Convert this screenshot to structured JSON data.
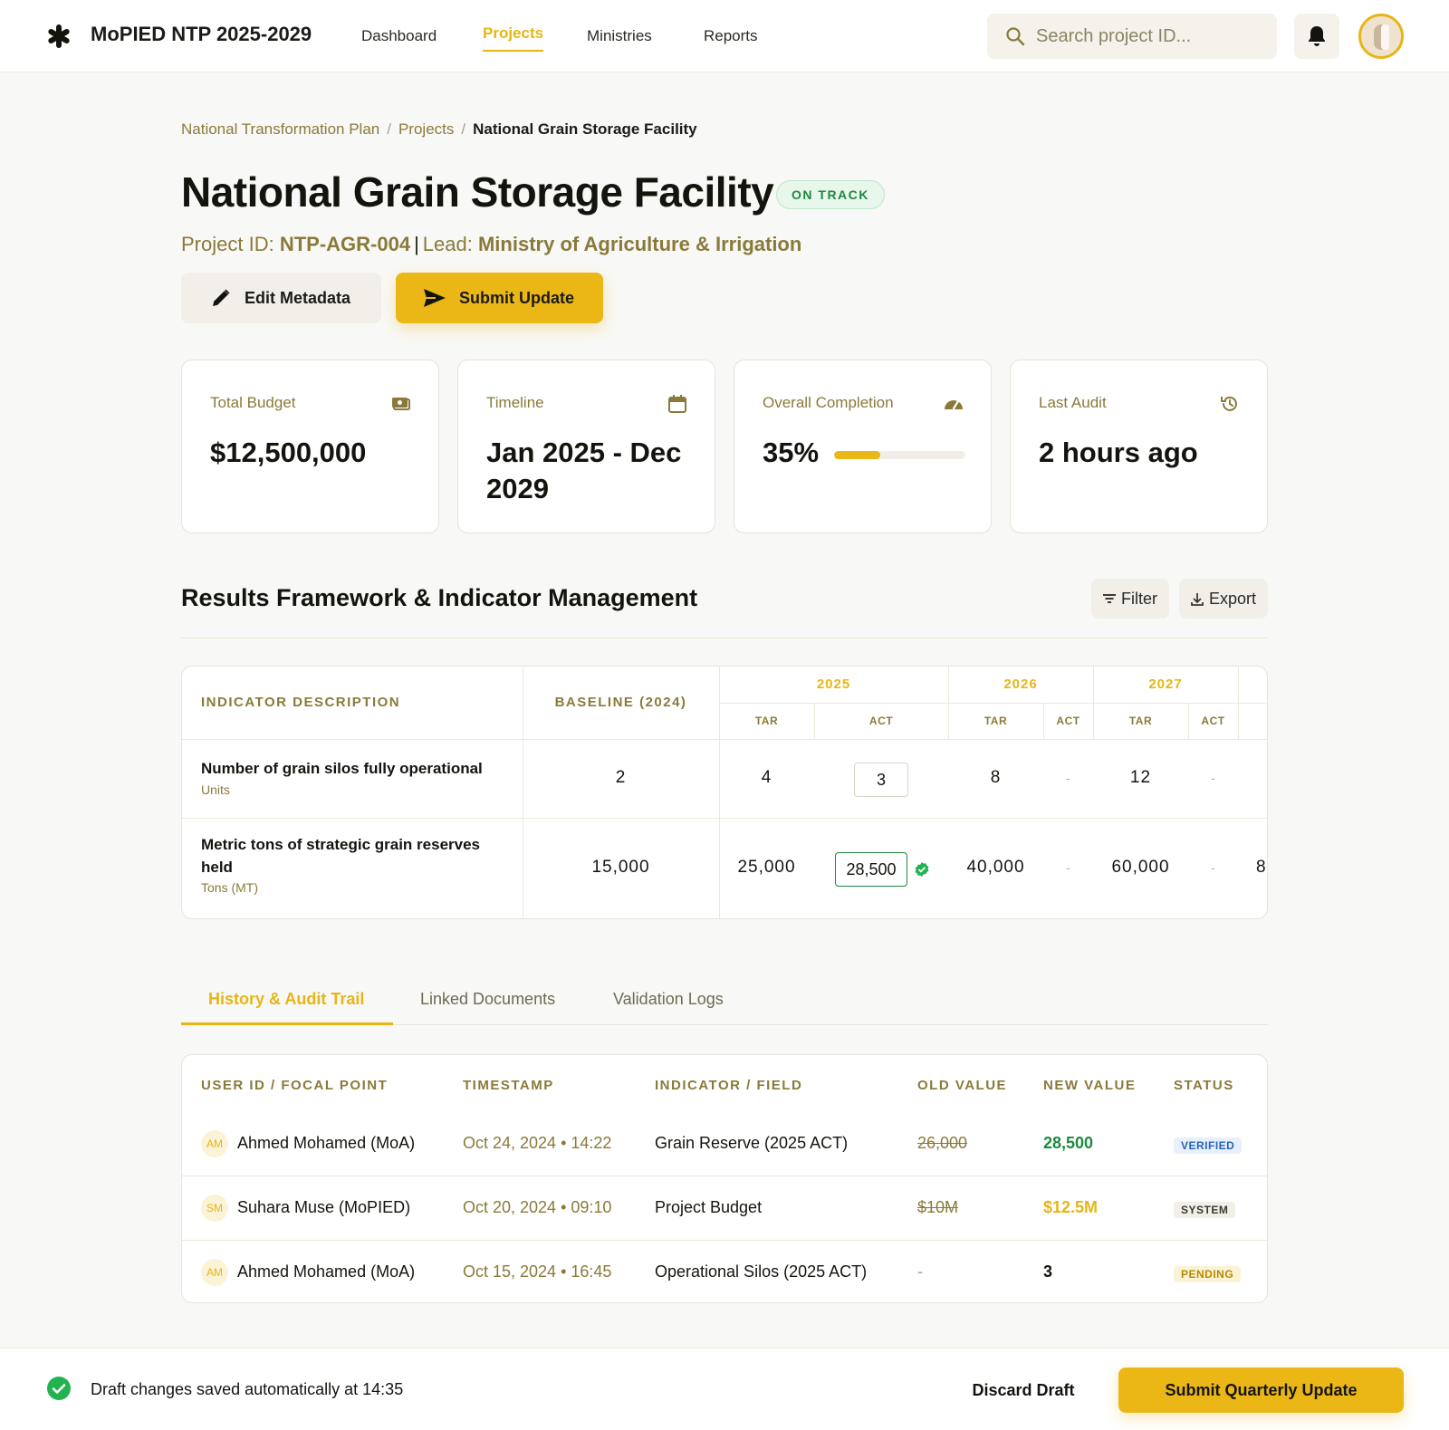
{
  "app": {
    "brand": "MoPIED NTP 2025-2029",
    "nav": [
      {
        "label": "Dashboard",
        "active": false
      },
      {
        "label": "Projects",
        "active": true
      },
      {
        "label": "Ministries",
        "active": false
      },
      {
        "label": "Reports",
        "active": false
      }
    ],
    "search_placeholder": "Search project ID...",
    "accent_color": "#ebb716"
  },
  "breadcrumb": [
    "National Transformation Plan",
    "Projects",
    "National Grain Storage Facility"
  ],
  "project": {
    "title": "National Grain Storage Facility",
    "status": "ON TRACK",
    "id_label": "Project ID:",
    "id": "NTP-AGR-004",
    "lead_label": "Lead:",
    "lead": "Ministry of Agriculture & Irrigation"
  },
  "actions": {
    "edit": "Edit Metadata",
    "submit": "Submit Update"
  },
  "cards": [
    {
      "label": "Total Budget",
      "value": "$12,500,000",
      "icon": "money-icon"
    },
    {
      "label": "Timeline",
      "value": "Jan 2025 - Dec 2029",
      "icon": "calendar-icon"
    },
    {
      "label": "Overall Completion",
      "value": "35%",
      "progress": 35,
      "icon": "gauge-icon"
    },
    {
      "label": "Last Audit",
      "value": "2 hours ago",
      "icon": "history-icon"
    }
  ],
  "results": {
    "title": "Results Framework & Indicator Management",
    "filter": "Filter",
    "export": "Export",
    "headers": {
      "indicator": "INDICATOR DESCRIPTION",
      "baseline": "BASELINE (2024)",
      "years": [
        "2025",
        "2026",
        "2027"
      ],
      "tar": "TAR",
      "act": "ACT"
    },
    "rows": [
      {
        "name": "Number of grain silos fully operational",
        "unit": "Units",
        "baseline": "2",
        "t2025": "4",
        "a2025": "3",
        "t2026": "8",
        "a2026": "-",
        "t2027": "12",
        "a2027": "-",
        "overflow": ""
      },
      {
        "name": "Metric tons of strategic grain reserves held",
        "unit": "Tons (MT)",
        "baseline": "15,000",
        "t2025": "25,000",
        "a2025": "28,500",
        "t2026": "40,000",
        "a2026": "-",
        "t2027": "60,000",
        "a2027": "-",
        "overflow": "8"
      }
    ]
  },
  "tabs": [
    "History & Audit Trail",
    "Linked Documents",
    "Validation Logs"
  ],
  "audit": {
    "headers": [
      "USER ID / FOCAL POINT",
      "TIMESTAMP",
      "INDICATOR / FIELD",
      "OLD VALUE",
      "NEW VALUE",
      "STATUS"
    ],
    "rows": [
      {
        "initials": "AM",
        "user": "Ahmed Mohamed (MoA)",
        "time": "Oct 24, 2024 • 14:22",
        "field": "Grain Reserve (2025 ACT)",
        "old": "26,000",
        "new": "28,500",
        "new_color": "#1c8a3f",
        "status": "VERIFIED",
        "status_bg": "#e8f0fb",
        "status_fg": "#2563b8"
      },
      {
        "initials": "SM",
        "user": "Suhara Muse (MoPIED)",
        "time": "Oct 20, 2024 • 09:10",
        "field": "Project Budget",
        "old": "$10M",
        "new": "$12.5M",
        "new_color": "#e7b514",
        "status": "SYSTEM",
        "status_bg": "#f1efe8",
        "status_fg": "#3a3a32"
      },
      {
        "initials": "AM",
        "user": "Ahmed Mohamed (MoA)",
        "time": "Oct 15, 2024 • 16:45",
        "field": "Operational Silos (2025 ACT)",
        "old": "-",
        "new": "3",
        "new_color": "#14140f",
        "status": "PENDING",
        "status_bg": "#fbf3d6",
        "status_fg": "#b88a00"
      }
    ]
  },
  "footer": {
    "message": "Draft changes saved automatically at 14:35",
    "discard": "Discard Draft",
    "submit": "Submit Quarterly Update"
  }
}
